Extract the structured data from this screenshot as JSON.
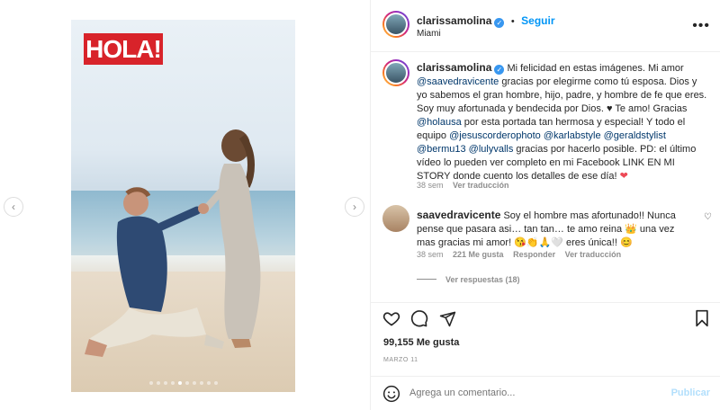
{
  "post": {
    "hola_logo": "HOLA!",
    "carousel_count": 10,
    "carousel_active": 5
  },
  "header": {
    "username": "clarissamolina",
    "follow_label": "Seguir",
    "location": "Miami",
    "more_label": "•••"
  },
  "caption": {
    "username": "clarissamolina",
    "parts": [
      {
        "t": " Mi felicidad en estas imágenes. Mi amor "
      },
      {
        "m": "@saavedravicente"
      },
      {
        "t": " gracias por elegirme como tú esposa. Dios y yo sabemos el gran hombre, hijo, padre, y hombre de fe que eres. Soy muy afortunada y bendecida por Dios. ♥ Te amo! Gracias "
      },
      {
        "m": "@holausa"
      },
      {
        "t": " por esta portada tan hermosa y especial! Y todo el equipo "
      },
      {
        "m": "@jesuscorderophoto"
      },
      {
        "t": " "
      },
      {
        "m": "@karlabstyle"
      },
      {
        "t": " "
      },
      {
        "m": "@geraldstylist"
      },
      {
        "t": " "
      },
      {
        "m": "@bermu13"
      },
      {
        "t": " "
      },
      {
        "m": "@lulyvalls"
      },
      {
        "t": " gracias por hacerlo posible. PD: el último vídeo lo pueden ver completo en mi Facebook LINK EN MI STORY donde cuento los detalles de ese día! "
      }
    ],
    "age": "38 sem",
    "translate_label": "Ver traducción"
  },
  "comment": {
    "username": "saavedravicente",
    "text": " Soy el hombre mas afortunado!! Nunca pense que pasara asi… tan tan… te amo reina 👑 una vez mas gracias mi amor! 😘👏🙏🤍 eres única!! 😊",
    "age": "38 sem",
    "likes": "221 Me gusta",
    "reply_label": "Responder",
    "translate_label": "Ver traducción",
    "replies_label": "Ver respuestas (18)"
  },
  "actions": {
    "likes": "99,155 Me gusta",
    "date": "MARZO 11"
  },
  "composer": {
    "placeholder": "Agrega un comentario...",
    "publish_label": "Publicar"
  },
  "colors": {
    "link": "#0095f6",
    "mention": "#00376b",
    "hola_red": "#d8232a"
  }
}
